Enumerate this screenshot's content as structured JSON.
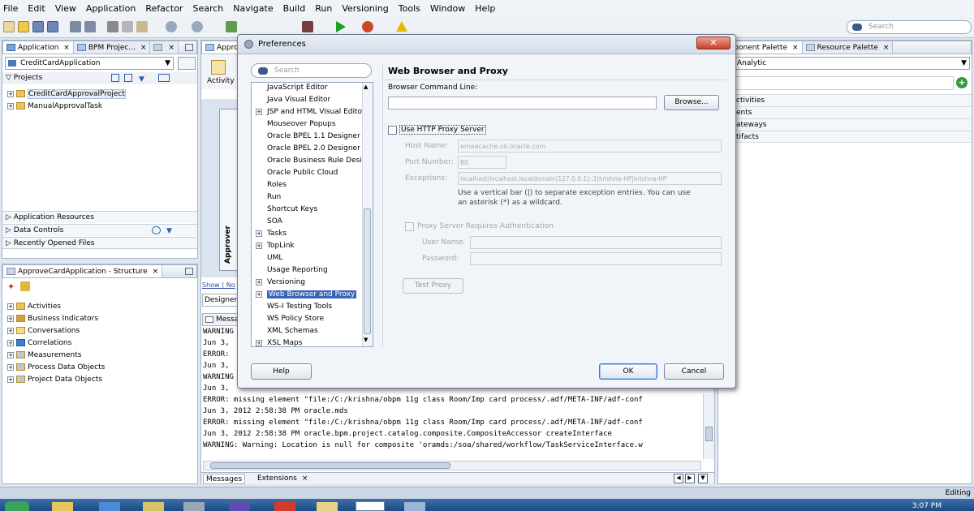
{
  "menu": [
    "File",
    "Edit",
    "View",
    "Application",
    "Refactor",
    "Search",
    "Navigate",
    "Build",
    "Run",
    "Versioning",
    "Tools",
    "Window",
    "Help"
  ],
  "top_search_placeholder": "Search",
  "left_panel": {
    "tabs": [
      "Application",
      "BPM Projec..."
    ],
    "app_selector": "CreditCardApplication",
    "projects_label": "Projects",
    "projects": [
      "CreditCardApprovalProject",
      "ManualApprovalTask"
    ],
    "accordion": [
      "Application Resources",
      "Data Controls",
      "Recently Opened Files"
    ]
  },
  "structure_panel": {
    "title": "ApproveCardApplication - Structure",
    "items": [
      "Activities",
      "Business Indicators",
      "Conversations",
      "Correlations",
      "Measurements",
      "Process Data Objects",
      "Project Data Objects"
    ]
  },
  "center": {
    "tab": "Approv",
    "activity_label": "Activity",
    "approver_label": "Approver",
    "show_link": "Show ( No",
    "designer_tab": "Designer",
    "messages_title": "Messa",
    "log_partial": [
      "WARNING",
      "Jun 3,",
      "ERROR:",
      "Jun 3,",
      "WARNING",
      "Jun 3,"
    ],
    "log_lines": [
      "ERROR: missing element \"file:/C:/krishna/obpm 11g class Room/Imp card process/.adf/META-INF/adf-conf",
      "Jun 3, 2012 2:58:38 PM oracle.mds",
      "ERROR: missing element \"file:/C:/krishna/obpm 11g class Room/Imp card process/.adf/META-INF/adf-conf",
      "Jun 3, 2012 2:58:38 PM oracle.bpm.project.catalog.composite.CompositeAccessor createInterface",
      "WARNING: Warning: Location is null for composite 'oramds:/soa/shared/workflow/TaskServiceInterface.w"
    ],
    "bottom_tabs": [
      "Messages",
      "Extensions"
    ]
  },
  "right_panel": {
    "tabs": [
      "omponent Palette",
      "Resource Palette"
    ],
    "selector": "Analytic",
    "items": [
      "ctivities",
      "ents",
      "ateways",
      "tifacts"
    ]
  },
  "dialog": {
    "title": "Preferences",
    "search_placeholder": "Search",
    "tree": [
      {
        "label": "JavaScript Editor",
        "expand": false
      },
      {
        "label": "Java Visual Editor",
        "expand": false
      },
      {
        "label": "JSP and HTML Visual Editor",
        "expand": true
      },
      {
        "label": "Mouseover Popups",
        "expand": false
      },
      {
        "label": "Oracle BPEL 1.1 Designer",
        "expand": false
      },
      {
        "label": "Oracle BPEL 2.0 Designer",
        "expand": false
      },
      {
        "label": "Oracle Business Rule Design",
        "expand": false
      },
      {
        "label": "Oracle Public Cloud",
        "expand": false
      },
      {
        "label": "Roles",
        "expand": false
      },
      {
        "label": "Run",
        "expand": false
      },
      {
        "label": "Shortcut Keys",
        "expand": false
      },
      {
        "label": "SOA",
        "expand": false
      },
      {
        "label": "Tasks",
        "expand": true
      },
      {
        "label": "TopLink",
        "expand": true
      },
      {
        "label": "UML",
        "expand": false
      },
      {
        "label": "Usage Reporting",
        "expand": false
      },
      {
        "label": "Versioning",
        "expand": true
      },
      {
        "label": "Web Browser and Proxy",
        "expand": true,
        "selected": true
      },
      {
        "label": "WS-I Testing Tools",
        "expand": false
      },
      {
        "label": "WS Policy Store",
        "expand": false
      },
      {
        "label": "XML Schemas",
        "expand": false
      },
      {
        "label": "XSL Maps",
        "expand": true
      }
    ],
    "section_title": "Web Browser and Proxy",
    "browser_cmd_label": "Browser Command Line:",
    "browse_button": "Browse...",
    "use_proxy_label": "Use HTTP Proxy Server",
    "host_label": "Host Name:",
    "host_value": "emeacache.uk.oracle.com",
    "port_label": "Port Number:",
    "port_value": "80",
    "exceptions_label": "Exceptions:",
    "exceptions_value": "localhost|localhost.localdomain|127.0.0.1|::1|krishna-HP|krishna-HP",
    "hint": "Use a vertical bar (|) to separate exception entries.  You can use an asterisk (*) as a wildcard.",
    "auth_label": "Proxy Server Requires Authentication",
    "user_label": "User Name:",
    "password_label": "Password:",
    "test_button": "Test Proxy",
    "help_button": "Help",
    "ok_button": "OK",
    "cancel_button": "Cancel"
  },
  "status": {
    "editing": "Editing",
    "clock": "3:07 PM"
  }
}
